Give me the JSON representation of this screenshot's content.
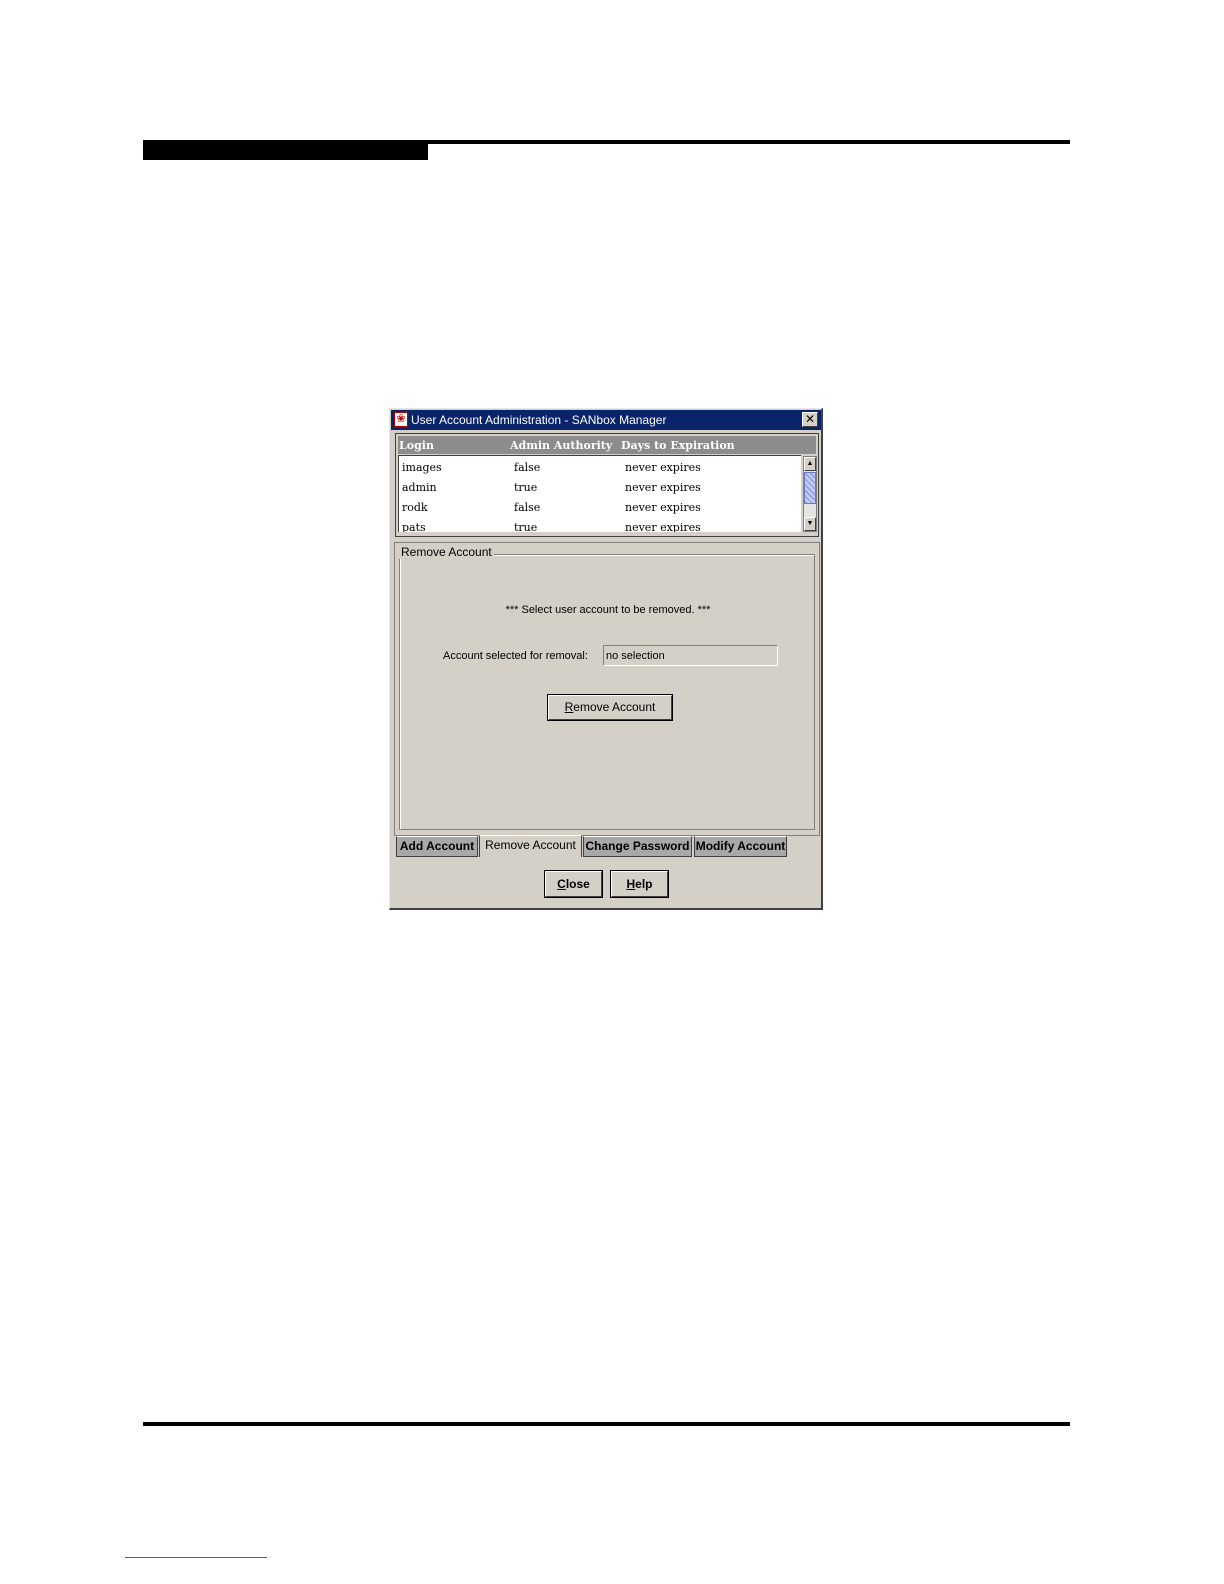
{
  "window": {
    "title": "User Account Administration - SANbox Manager",
    "close_glyph": "✕",
    "icon_name": "app-icon"
  },
  "table": {
    "columns": [
      "Login",
      "Admin Authority",
      "Days to Expiration"
    ],
    "rows": [
      [
        "images",
        "false",
        "never expires"
      ],
      [
        "admin",
        "true",
        "never expires"
      ],
      [
        "rodk",
        "false",
        "never expires"
      ],
      [
        "pats",
        "true",
        "never expires"
      ]
    ]
  },
  "panel": {
    "legend": "Remove Account",
    "instruction": "*** Select user account to be removed. ***",
    "selected_label": "Account selected for removal:",
    "selected_value": "no selection",
    "remove_button": {
      "first": "R",
      "rest": "emove Account"
    }
  },
  "tabs": {
    "add": "Add Account",
    "remove": "Remove Account",
    "change": "Change Password",
    "modify": "Modify Account",
    "active": "remove"
  },
  "buttons": {
    "close": {
      "first": "C",
      "rest": "lose"
    },
    "help": {
      "first": "H",
      "rest": "elp"
    }
  },
  "colors": {
    "titlebar": "#0a246a",
    "dialog_bg": "#d4d0c8",
    "header_bg": "#8c8c8c"
  }
}
